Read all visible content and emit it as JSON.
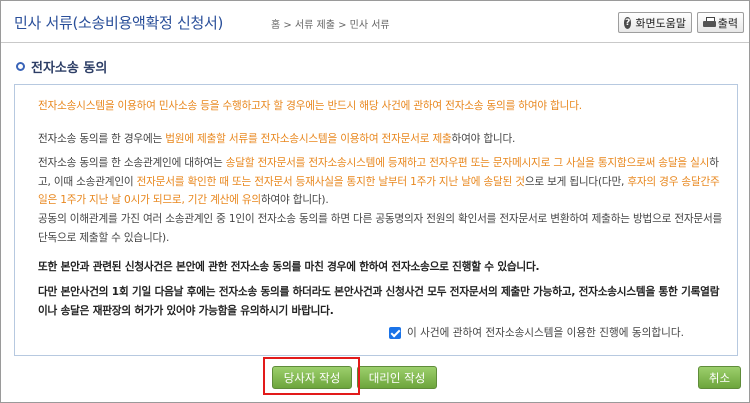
{
  "header": {
    "title": "민사 서류(소송비용액확정 신청서)",
    "breadcrumb": "홈 > 서류 제출 > 민사 서류",
    "help_label": "화면도움말",
    "print_label": "출력"
  },
  "section": {
    "title": "전자소송 동의"
  },
  "content": {
    "p1": "전자소송시스템을 이용하여 민사소송 등을 수행하고자 할 경우에는 반드시 해당 사건에 관하여 전자소송 동의를 하여야 합니다.",
    "p2_a": "전자소송 동의를 한 경우에는 ",
    "p2_b": "법원에 제출할 서류를 전자소송시스템을 이용하여 전자문서로 제출",
    "p2_c": "하여야 합니다.",
    "p3_a": "전자소송 동의를 한 소송관계인에 대하여는 ",
    "p3_b": "송달할 전자문서를 전자소송시스템에 등재하고 전자우편 또는 문자메시지로 그 사실을 통지함으로써 송달을 실시",
    "p3_c": "하고, 이때 소송관계인이 ",
    "p3_d": "전자문서를 확인한 때 또는 전자문서 등재사실을 통지한 날부터 1주가 지난 날에 송달된 것",
    "p3_e": "으로 보게 됩니다(다만, ",
    "p3_f": "후자의 경우 송달간주일은 1주가 지난 날 0시가 되므로, 기간 계산에 유의",
    "p3_g": "하여야 합니다).",
    "p4": "공동의 이해관계를 가진 여러 소송관계인 중 1인이 전자소송 동의를 하면 다른 공동명의자 전원의 확인서를 전자문서로 변환하여 제출하는 방법으로 전자문서를 단독으로 제출할 수 있습니다).",
    "p5": "또한 본안과 관련된 신청사건은 본안에 관한 전자소송 동의를 마친 경우에 한하여 전자소송으로 진행할 수 있습니다.",
    "p6": "다만 본안사건의 1회 기일 다음날 후에는 전자소송 동의를 하더라도 본안사건과 신청사건 모두 전자문서의 제출만 가능하고, 전자소송시스템을 통한 기록열람이나 송달은 재판장의 허가가 있어야 가능함을 유의하시기 바랍니다.",
    "agree_label": "이 사건에 관하여 전자소송시스템을 이용한 진행에 동의합니다.",
    "agree_checked": true
  },
  "buttons": {
    "party": "당사자 작성",
    "agent": "대리인 작성",
    "cancel": "취소"
  },
  "colors": {
    "accent_title": "#2a4f9a",
    "highlight_text": "#e8871e",
    "button_green": "#6da53c",
    "highlight_box": "#e21a1a",
    "checkbox": "#1a73e8"
  }
}
